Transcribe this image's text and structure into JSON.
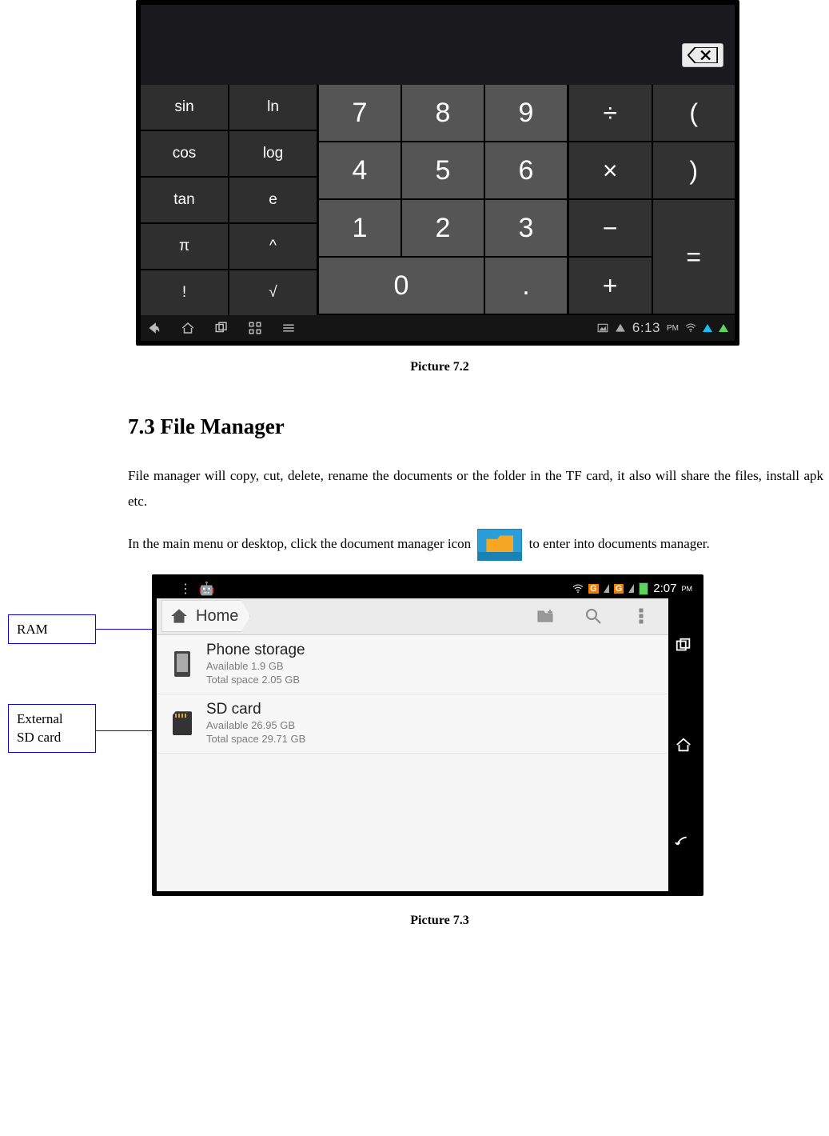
{
  "calculator": {
    "fn_keys": [
      "sin",
      "ln",
      "cos",
      "log",
      "tan",
      "e",
      "π",
      "^",
      "!",
      "√"
    ],
    "num_keys": [
      "7",
      "8",
      "9",
      "4",
      "5",
      "6",
      "1",
      "2",
      "3",
      "0",
      "."
    ],
    "op_keys": {
      "div": "÷",
      "lp": "(",
      "mul": "×",
      "rp": ")",
      "sub": "−",
      "eq": "=",
      "add": "+"
    },
    "backspace_label": "×",
    "time": "6:13",
    "time_suffix": "PM"
  },
  "captions": {
    "calc": "Picture 7.2",
    "fm": "Picture 7.3"
  },
  "section": {
    "heading": "7.3 File Manager",
    "para1": "File manager will copy, cut, delete, rename the documents or the folder in the TF card, it also will share the files, install apk etc.",
    "para2_a": "In the main menu or desktop, click the document manager icon",
    "para2_b": "to enter into documents manager.",
    "inline_icon_label": "File Manager"
  },
  "filemanager": {
    "time": "2:07",
    "time_suffix": "PM",
    "g_badge": "G",
    "breadcrumb": "Home",
    "items": [
      {
        "title": "Phone storage",
        "line1": "Available 1.9 GB",
        "line2": "Total space 2.05 GB"
      },
      {
        "title": "SD card",
        "line1": "Available 26.95 GB",
        "line2": "Total space 29.71 GB"
      }
    ]
  },
  "callouts": {
    "ram": "RAM",
    "sd": "External\nSD card"
  }
}
